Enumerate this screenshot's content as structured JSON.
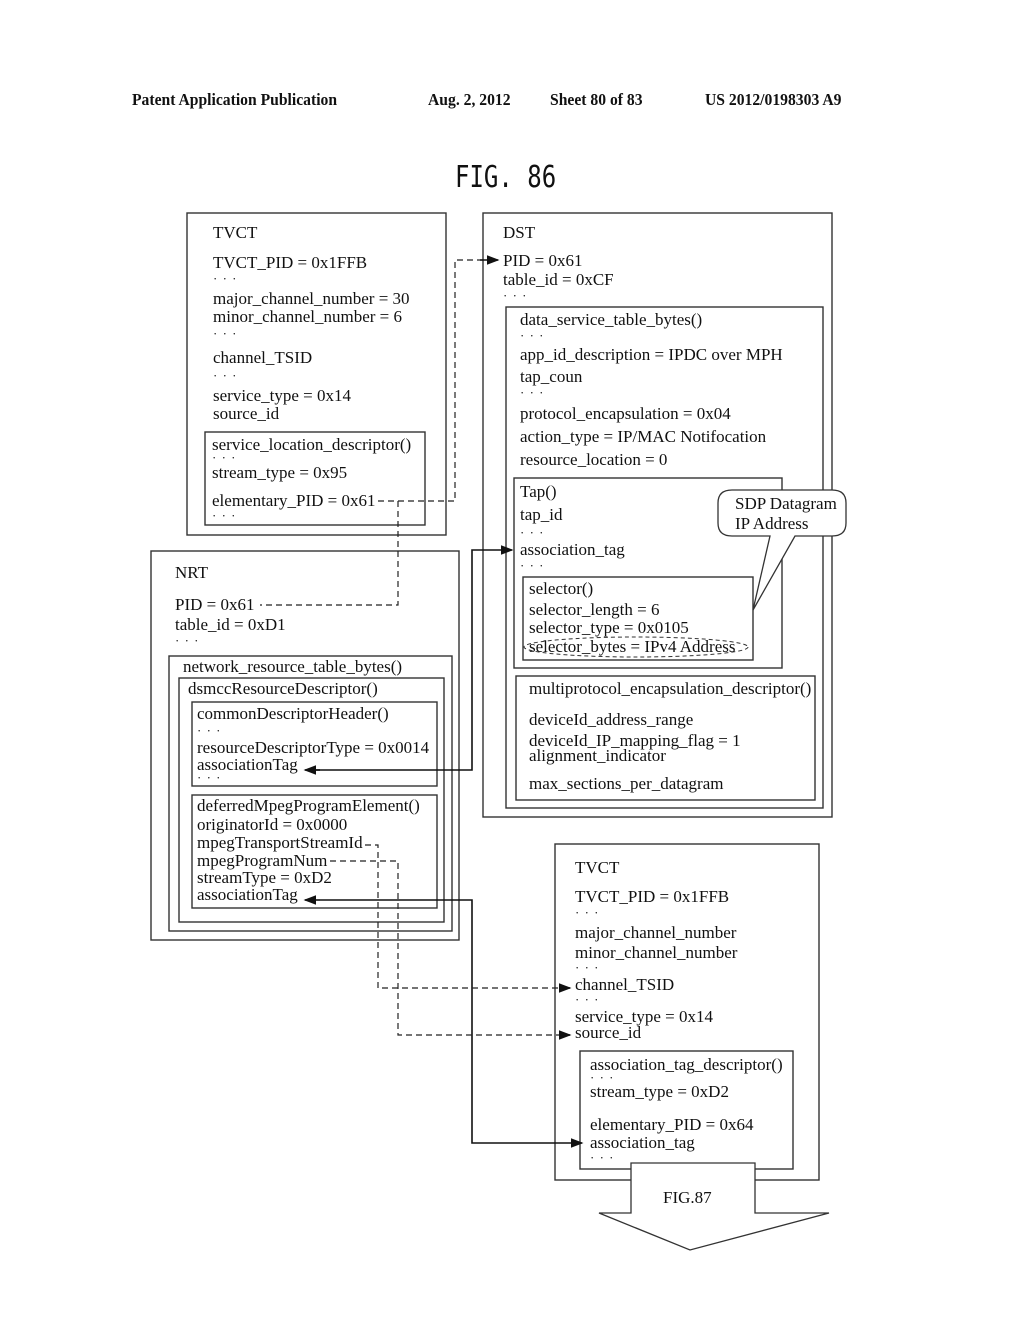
{
  "header": {
    "publication": "Patent Application Publication",
    "date": "Aug. 2, 2012",
    "sheet": "Sheet 80 of 83",
    "number": "US 2012/0198303 A9"
  },
  "figure": {
    "title": "FIG. 86",
    "next_figure": "FIG.87"
  },
  "tvct_top": {
    "title": "TVCT",
    "lines": [
      "TVCT_PID = 0x1FFB",
      "major_channel_number = 30",
      "minor_channel_number = 6",
      "channel_TSID",
      "service_type = 0x14",
      "source_id"
    ],
    "descriptor": {
      "title": "service_location_descriptor()",
      "lines": [
        "stream_type = 0x95",
        "elementary_PID = 0x61"
      ]
    }
  },
  "dst": {
    "title": "DST",
    "lines": [
      "PID = 0x61",
      "table_id = 0xCF"
    ],
    "data_service_table": {
      "title": "data_service_table_bytes()",
      "lines": [
        "app_id_description = IPDC over MPH",
        "tap_coun",
        "protocol_encapsulation = 0x04",
        "action_type = IP/MAC Notifocation",
        "resource_location = 0"
      ],
      "tap": {
        "title": "Tap()",
        "lines": [
          "tap_id",
          "association_tag"
        ],
        "selector": {
          "title": "selector()",
          "lines": [
            "selector_length = 6",
            "selector_type = 0x0105",
            "selector_bytes = IPv4 Address"
          ]
        }
      },
      "callout": [
        "SDP Datagram",
        "IP Address"
      ],
      "mpe_descriptor": {
        "title": "multiprotocol_encapsulation_descriptor()",
        "lines": [
          "deviceId_address_range",
          "deviceId_IP_mapping_flag = 1",
          "alignment_indicator",
          "max_sections_per_datagram"
        ]
      }
    }
  },
  "nrt": {
    "title": "NRT",
    "lines": [
      "PID = 0x61",
      "table_id = 0xD1"
    ],
    "nrt_bytes": {
      "title": "network_resource_table_bytes()",
      "dsmcc": {
        "title": "dsmccResourceDescriptor()",
        "common_header": {
          "title": "commonDescriptorHeader()",
          "lines": [
            "resourceDescriptorType = 0x0014",
            "associationTag"
          ]
        },
        "deferred": {
          "title": "deferredMpegProgramElement()",
          "lines": [
            "originatorId = 0x0000",
            "mpegTransportStreamId",
            "mpegProgramNum",
            "streamType = 0xD2",
            "associationTag"
          ]
        }
      }
    }
  },
  "tvct_bottom": {
    "title": "TVCT",
    "lines": [
      "TVCT_PID = 0x1FFB",
      "major_channel_number",
      "minor_channel_number",
      "channel_TSID",
      "service_type = 0x14",
      "source_id"
    ],
    "descriptor": {
      "title": "association_tag_descriptor()",
      "lines": [
        "stream_type = 0xD2",
        "elementary_PID = 0x64",
        "association_tag"
      ]
    }
  },
  "ellipsis": "· · ·"
}
